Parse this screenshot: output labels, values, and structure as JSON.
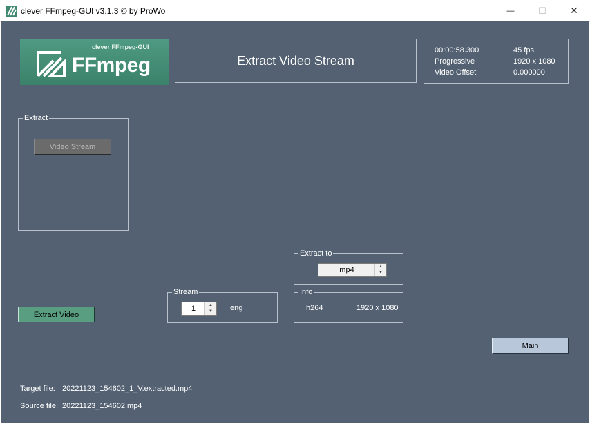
{
  "window": {
    "title": "clever FFmpeg-GUI v3.1.3   © by ProWo",
    "minimize": "—",
    "maximize": "☐",
    "close": "✕"
  },
  "logo": {
    "small_text": "clever FFmpeg-GUI",
    "big_text": "FFmpeg"
  },
  "header": {
    "title": "Extract Video Stream"
  },
  "media_info": {
    "duration": "00:00:58.300",
    "fps": "45 fps",
    "scan": "Progressive",
    "resolution": "1920 x 1080",
    "offset_label": "Video Offset",
    "offset_value": "0.000000"
  },
  "extract_group": {
    "legend": "Extract",
    "video_stream_button": "Video Stream"
  },
  "extract_to_group": {
    "legend": "Extract to",
    "format": "mp4"
  },
  "stream_group": {
    "legend": "Stream",
    "number": "1",
    "language": "eng"
  },
  "info_group": {
    "legend": "Info",
    "codec": "h264",
    "resolution": "1920 x 1080"
  },
  "buttons": {
    "extract_video": "Extract Video",
    "main": "Main"
  },
  "files": {
    "target_label": "Target file:",
    "target_value": "20221123_154602_1_V.extracted.mp4",
    "source_label": "Source file:",
    "source_value": "20221123_154602.mp4"
  },
  "colors": {
    "background": "#536172",
    "logo_green": "#3f8770",
    "extract_button": "#5a9e82",
    "main_button": "#b8c7da"
  }
}
